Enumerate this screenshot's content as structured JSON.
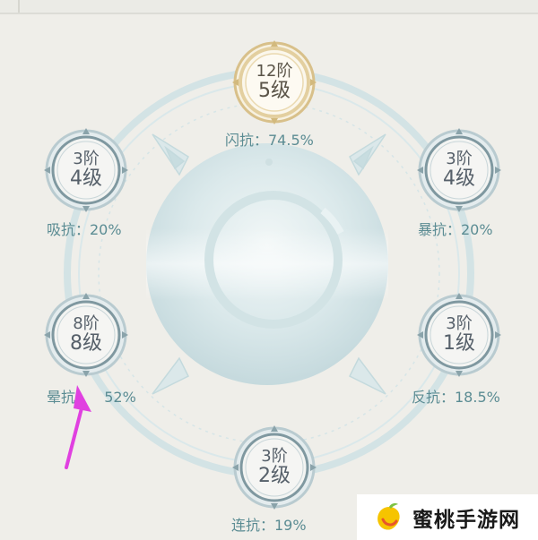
{
  "nodes": [
    {
      "id": "top",
      "tier": "12阶",
      "level": "5级",
      "label": "闪抗：74.5%",
      "style": "gold"
    },
    {
      "id": "upper-left",
      "tier": "3阶",
      "level": "4级",
      "label": "吸抗：20%",
      "style": "normal"
    },
    {
      "id": "upper-right",
      "tier": "3阶",
      "level": "4级",
      "label": "暴抗：20%",
      "style": "normal"
    },
    {
      "id": "lower-left",
      "tier": "8阶",
      "level": "8级",
      "label_name": "晕抗",
      "label_value": "52%",
      "style": "normal"
    },
    {
      "id": "lower-right",
      "tier": "3阶",
      "level": "1级",
      "label": "反抗：18.5%",
      "style": "normal"
    },
    {
      "id": "bottom",
      "tier": "3阶",
      "level": "2级",
      "label": "连抗：19%",
      "style": "normal"
    }
  ],
  "watermark": {
    "text": "蜜桃手游网",
    "logo": "peach-logo-icon"
  },
  "annotation": {
    "arrow_color": "#e040e0",
    "icon": "arrow-icon"
  },
  "colors": {
    "background": "#efeee9",
    "ring": "#c9dde0",
    "label": "#5b8c93",
    "gold": "#d8c08a"
  }
}
